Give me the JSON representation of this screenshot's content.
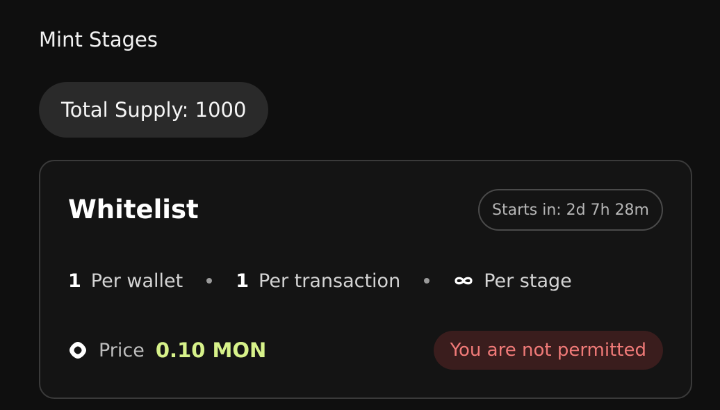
{
  "section": {
    "title": "Mint Stages"
  },
  "supply": {
    "label": "Total Supply: 1000"
  },
  "stage": {
    "name": "Whitelist",
    "starts_in": "Starts in: 2d 7h 28m",
    "limits": {
      "per_wallet_value": "1",
      "per_wallet_label": "Per wallet",
      "per_transaction_value": "1",
      "per_transaction_label": "Per transaction",
      "per_stage_icon": "infinity-icon",
      "per_stage_label": "Per stage"
    },
    "price": {
      "icon": "mon-token-icon",
      "label": "Price",
      "value": "0.10 MON"
    },
    "status": "You are not permitted"
  },
  "colors": {
    "background": "#0f0f0f",
    "card_border": "#3a3a3a",
    "price_accent": "#d7f28a",
    "error_text": "#f07a78",
    "error_bg": "#3a1d1d"
  }
}
